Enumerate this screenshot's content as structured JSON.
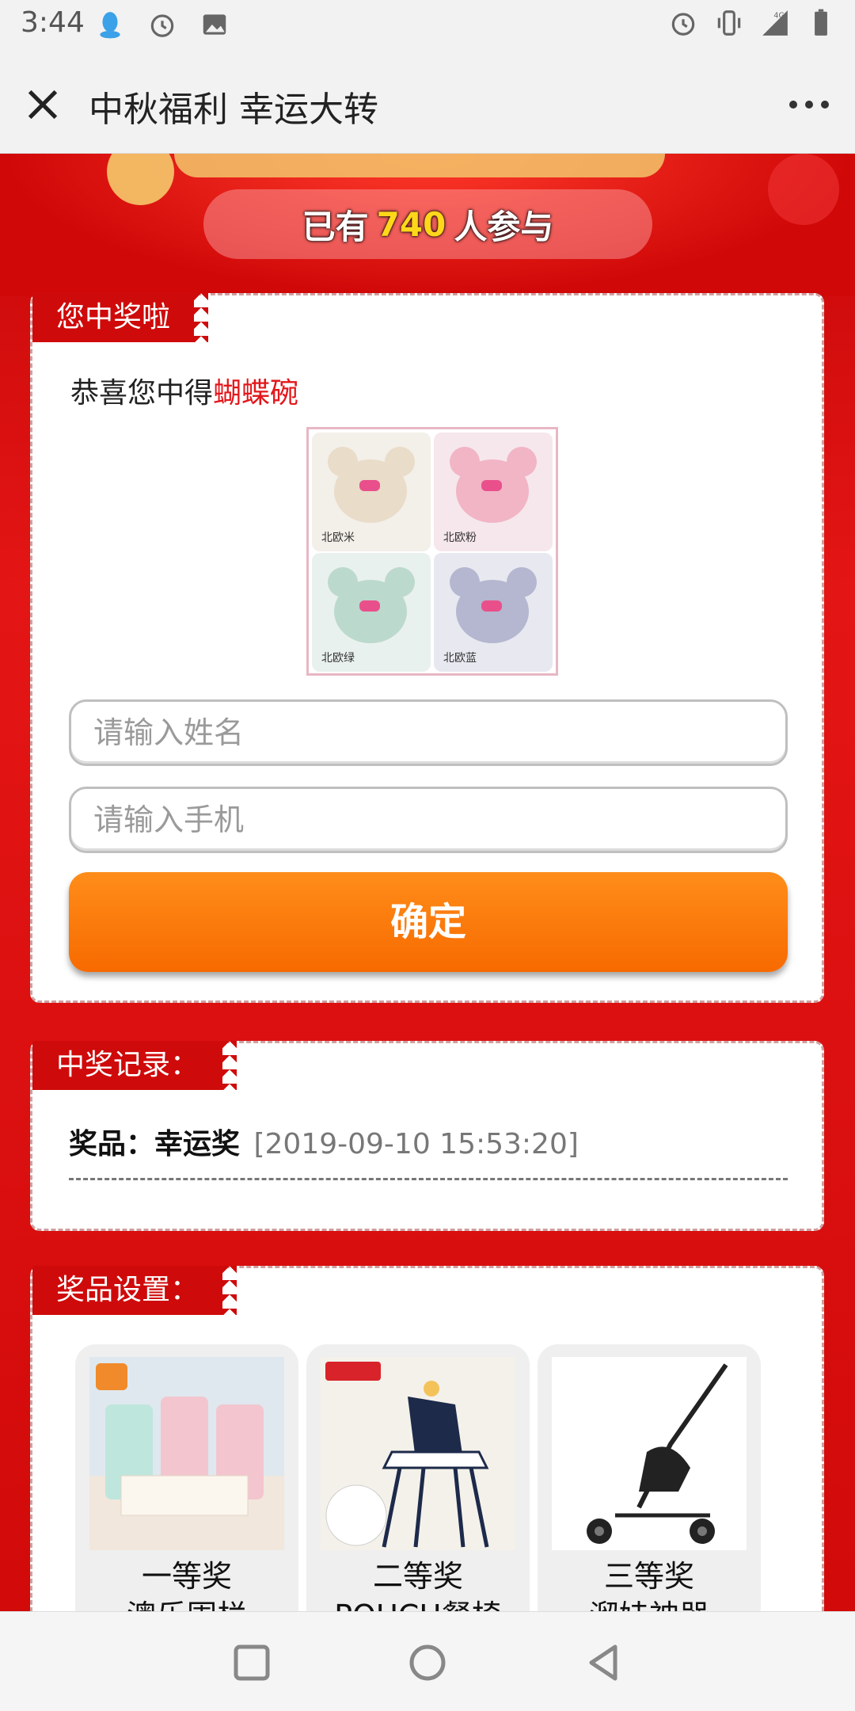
{
  "status": {
    "time": "3:44",
    "network": "4G"
  },
  "header": {
    "title": "中秋福利 幸运大转"
  },
  "banner": {
    "participants_prefix": "已有",
    "participants_count": "740",
    "participants_suffix": "人参与"
  },
  "win_card": {
    "tag": "您中奖啦",
    "congrats_prefix": "恭喜您中得",
    "prize_name": "蝴蝶碗",
    "bowls": [
      {
        "label": "北欧米",
        "color": "#e9dcc9"
      },
      {
        "label": "北欧粉",
        "color": "#f1b5c6"
      },
      {
        "label": "北欧绿",
        "color": "#bcd9cd"
      },
      {
        "label": "北欧蓝",
        "color": "#b4b7cf"
      }
    ],
    "name_placeholder": "请输入姓名",
    "phone_placeholder": "请输入手机",
    "confirm_label": "确定"
  },
  "record_card": {
    "tag": "中奖记录：",
    "entry_label": "奖品：幸运奖",
    "entry_time": "[2019-09-10 15:53:20]"
  },
  "settings_card": {
    "tag": "奖品设置：",
    "prizes": [
      {
        "rank": "一等奖",
        "name": "澳乐围栏"
      },
      {
        "rank": "二等奖",
        "name": "POUCH餐椅"
      },
      {
        "rank": "三等奖",
        "name": "溜娃神器"
      }
    ]
  },
  "colors": {
    "background_red": "#d20a0a",
    "tag_red": "#cf0a0a",
    "confirm_orange": "#f76a00",
    "highlight_yellow": "#ffd71a",
    "prize_text_red": "#e3171b"
  }
}
